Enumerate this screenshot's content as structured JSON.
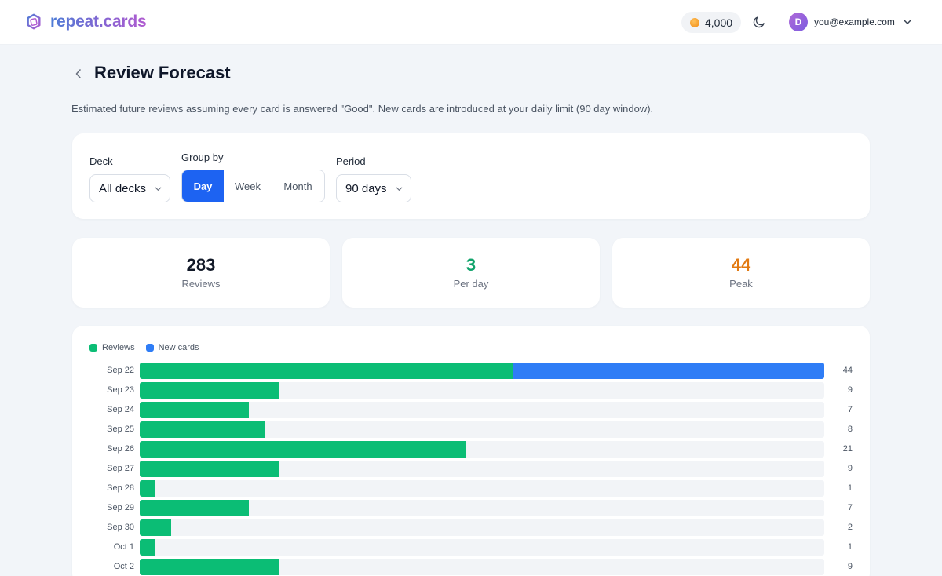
{
  "app": {
    "brand": "repeat.cards"
  },
  "header": {
    "coins": "4,000",
    "theme_icon": "moon-icon",
    "user": {
      "avatar_initial": "D",
      "email": "you@example.com"
    }
  },
  "page": {
    "title": "Review Forecast",
    "subtitle": "Estimated future reviews assuming every card is answered \"Good\". New cards are introduced at your daily limit (90 day window)."
  },
  "filters": {
    "deck_label": "Deck",
    "deck_value": "All decks",
    "group_label": "Group by",
    "group_options": [
      "Day",
      "Week",
      "Month"
    ],
    "group_selected": "Day",
    "period_label": "Period",
    "period_value": "90 days"
  },
  "stats": [
    {
      "value": "283",
      "label": "Reviews",
      "color": "#111827"
    },
    {
      "value": "3",
      "label": "Per day",
      "color": "#10a36b"
    },
    {
      "value": "44",
      "label": "Peak",
      "color": "#e27a12"
    }
  ],
  "colors": {
    "reviews": "#0bbd75",
    "new_cards": "#2f7df6",
    "accent": "#1d63f2"
  },
  "chart_data": {
    "type": "bar",
    "orientation": "horizontal",
    "stacked": true,
    "legend": [
      "Reviews",
      "New cards"
    ],
    "categories": [
      "Sep 22",
      "Sep 23",
      "Sep 24",
      "Sep 25",
      "Sep 26",
      "Sep 27",
      "Sep 28",
      "Sep 29",
      "Sep 30",
      "Oct 1",
      "Oct 2"
    ],
    "series": [
      {
        "name": "Reviews",
        "values": [
          24,
          9,
          7,
          8,
          21,
          9,
          1,
          7,
          2,
          1,
          9
        ]
      },
      {
        "name": "New cards",
        "values": [
          20,
          0,
          0,
          0,
          0,
          0,
          0,
          0,
          0,
          0,
          0
        ]
      }
    ],
    "totals": [
      44,
      9,
      7,
      8,
      21,
      9,
      1,
      7,
      2,
      1,
      9
    ],
    "xlim": [
      0,
      44
    ]
  }
}
